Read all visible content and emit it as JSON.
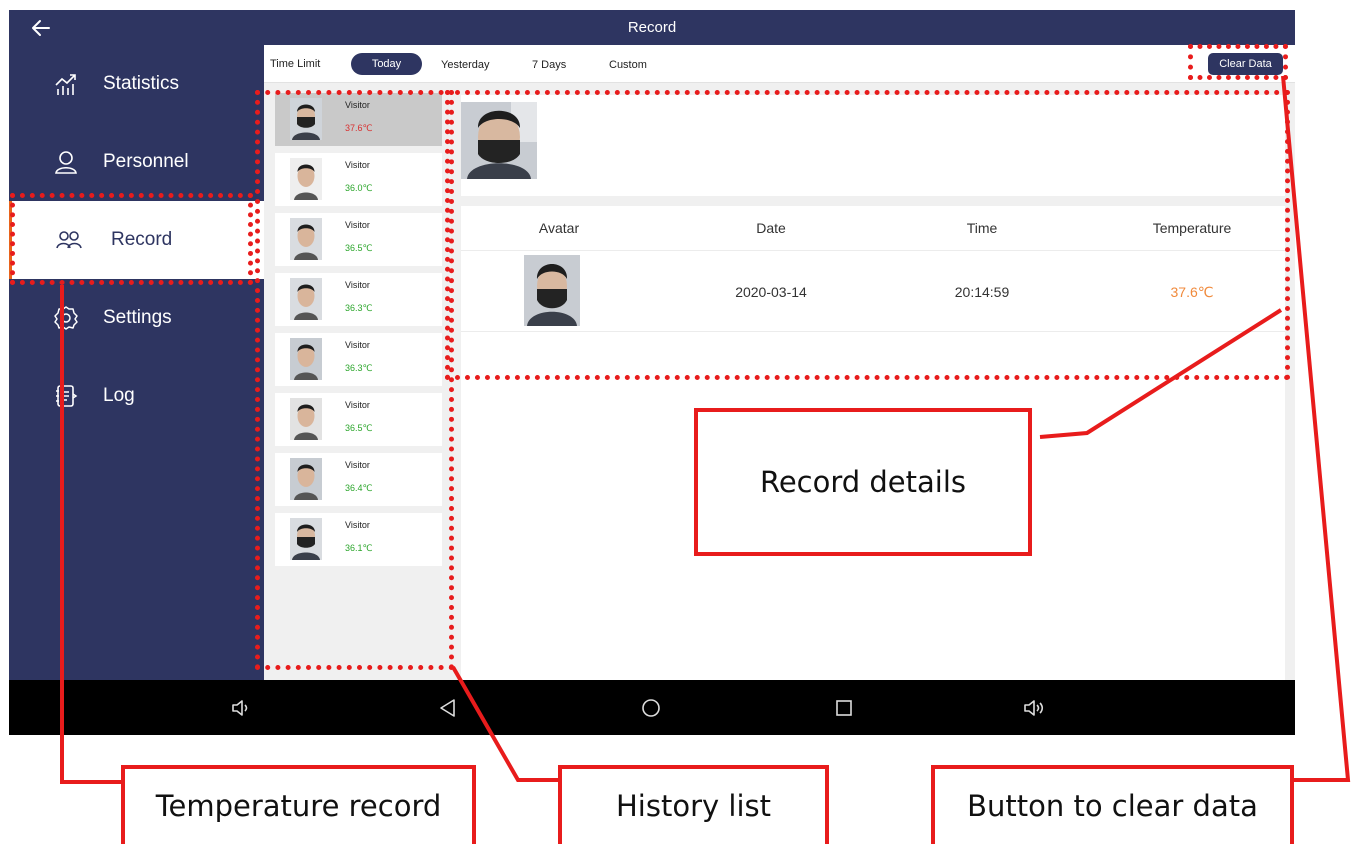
{
  "app": {
    "title": "Record"
  },
  "sidebar": {
    "items": [
      {
        "label": "Statistics",
        "icon": "chart-icon"
      },
      {
        "label": "Personnel",
        "icon": "person-icon"
      },
      {
        "label": "Record",
        "icon": "group-icon",
        "active": true
      },
      {
        "label": "Settings",
        "icon": "gear-icon"
      },
      {
        "label": "Log",
        "icon": "log-icon"
      }
    ]
  },
  "filter": {
    "label": "Time Limit",
    "tabs": [
      "Today",
      "Yesterday",
      "7 Days",
      "Custom"
    ],
    "active_tab": "Today",
    "clear_label": "Clear Data"
  },
  "history": [
    {
      "name": "Visitor",
      "temp": "37.6℃",
      "status": "high",
      "selected": true
    },
    {
      "name": "Visitor",
      "temp": "36.0℃",
      "status": "normal"
    },
    {
      "name": "Visitor",
      "temp": "36.5℃",
      "status": "normal"
    },
    {
      "name": "Visitor",
      "temp": "36.3℃",
      "status": "normal"
    },
    {
      "name": "Visitor",
      "temp": "36.3℃",
      "status": "normal"
    },
    {
      "name": "Visitor",
      "temp": "36.5℃",
      "status": "normal"
    },
    {
      "name": "Visitor",
      "temp": "36.4℃",
      "status": "normal"
    },
    {
      "name": "Visitor",
      "temp": "36.1℃",
      "status": "normal"
    }
  ],
  "detail": {
    "headers": [
      "Avatar",
      "Date",
      "Time",
      "Temperature"
    ],
    "row": {
      "date": "2020-03-14",
      "time": "20:14:59",
      "temperature": "37.6℃"
    }
  },
  "annotations": {
    "record_details": "Record details",
    "temperature_record": "Temperature record",
    "history_list": "History list",
    "clear_button": "Button to clear data"
  },
  "colors": {
    "primary": "#2e3561",
    "accent": "#e8631c",
    "temp_normal": "#2aa52a",
    "temp_high": "#d83030",
    "temp_warn": "#f08a3c",
    "annotation": "#e81c1c"
  }
}
